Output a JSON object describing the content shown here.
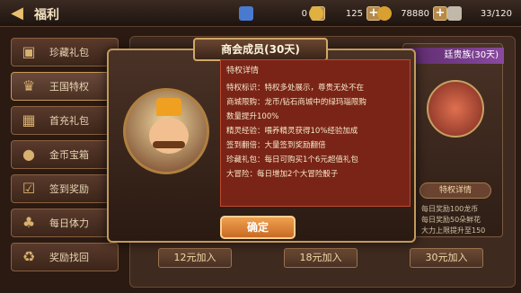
{
  "header": {
    "back_icon": "back-arrow-icon",
    "title": "福利",
    "resources": [
      {
        "icon": "gem-icon",
        "color": "#4a7ad0",
        "value": "0"
      },
      {
        "icon": "refresh-icon",
        "color": "#e0b040",
        "value": "125"
      },
      {
        "icon": "coin-icon",
        "color": "#d8a030",
        "value": "78880"
      },
      {
        "icon": "stamina-icon",
        "color": "#c0b8a8",
        "value": "33/120"
      }
    ],
    "plus_label": "+"
  },
  "sidebar": {
    "items": [
      {
        "label": "珍藏礼包",
        "icon": "chest-icon"
      },
      {
        "label": "王国特权",
        "icon": "crown-icon"
      },
      {
        "label": "首充礼包",
        "icon": "gift-icon"
      },
      {
        "label": "金币宝箱",
        "icon": "coin-chest-icon"
      },
      {
        "label": "签到奖励",
        "icon": "checkin-icon"
      },
      {
        "label": "每日体力",
        "icon": "stamina-icon"
      },
      {
        "label": "奖励找回",
        "icon": "recover-icon"
      }
    ],
    "active_index": 1
  },
  "main": {
    "right_card": {
      "title": "廷贵族(30天)",
      "detail_label": "特权详情",
      "lines": [
        "每日奖励100龙币",
        "每日奖励50朵鲜花",
        "大力上限提升至150"
      ]
    },
    "buy_buttons": [
      "12元加入",
      "18元加入",
      "30元加入"
    ]
  },
  "dialog": {
    "title": "商会成员(30天)",
    "heading": "特权详情",
    "lines": [
      "特权标识：特权多处展示，尊贵无处不在",
      "商城限购：龙币/钻石商城中的绿玛瑙限购",
      "数量提升100%",
      "精灵经验：喂养精灵获得10%经验加成",
      "签到翻倍：大量签到奖励翻倍",
      "珍藏礼包：每日可购买1个6元超值礼包",
      "大冒险：每日增加2个大冒险骰子"
    ],
    "confirm_label": "确定"
  }
}
